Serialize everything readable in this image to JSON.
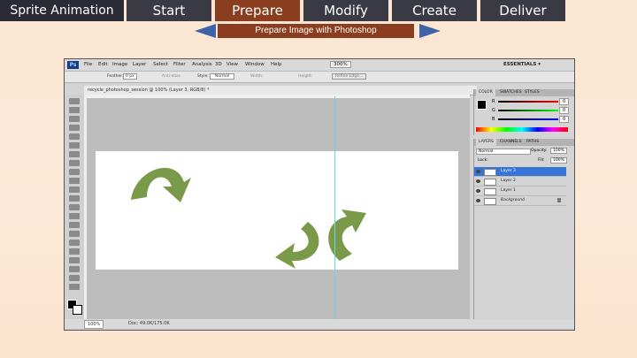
{
  "nav": {
    "title": "Sprite Animation",
    "tabs": [
      "Start",
      "Prepare",
      "Modify",
      "Create",
      "Deliver"
    ],
    "subtitle": "Prepare Image with Photoshop"
  },
  "photoshop": {
    "logo": "Ps",
    "menu": [
      "File",
      "Edit",
      "Image",
      "Layer",
      "Select",
      "Filter",
      "Analysis",
      "3D",
      "View",
      "Window",
      "Help"
    ],
    "zoom": "300%",
    "workspace": "ESSENTIALS ▾",
    "options": {
      "feather_label": "Feather:",
      "feather_value": "0 px",
      "antialias": "Anti-alias",
      "style_label": "Style:",
      "style_value": "Normal",
      "width_label": "Width:",
      "height_label": "Height:",
      "refine": "Refine Edge..."
    },
    "document_tab": "recycle_photoshop_session @ 100% (Layer 3, RGB/8) *",
    "status": {
      "zoom": "100%",
      "doc": "Doc: 49.0K/175.0K"
    },
    "color_panel": {
      "tabs": [
        "COLOR",
        "SWATCHES",
        "STYLES"
      ],
      "channels": [
        {
          "label": "R",
          "value": "0"
        },
        {
          "label": "G",
          "value": "0"
        },
        {
          "label": "B",
          "value": "0"
        }
      ]
    },
    "layers_panel": {
      "tabs": [
        "LAYERS",
        "CHANNELS",
        "PATHS"
      ],
      "blend": "Normal",
      "opacity_label": "Opacity:",
      "opacity": "100%",
      "lock_label": "Lock:",
      "fill_label": "Fill:",
      "fill": "100%",
      "layers": [
        "Layer 3",
        "Layer 2",
        "Layer 1",
        "Background"
      ],
      "selected": "Layer 3"
    }
  },
  "colors": {
    "arrow_green": "#7a9a4a",
    "nav_dark": "#3a3a44",
    "nav_brown": "#8b3e1f",
    "arrow_blue": "#3e63a9"
  }
}
